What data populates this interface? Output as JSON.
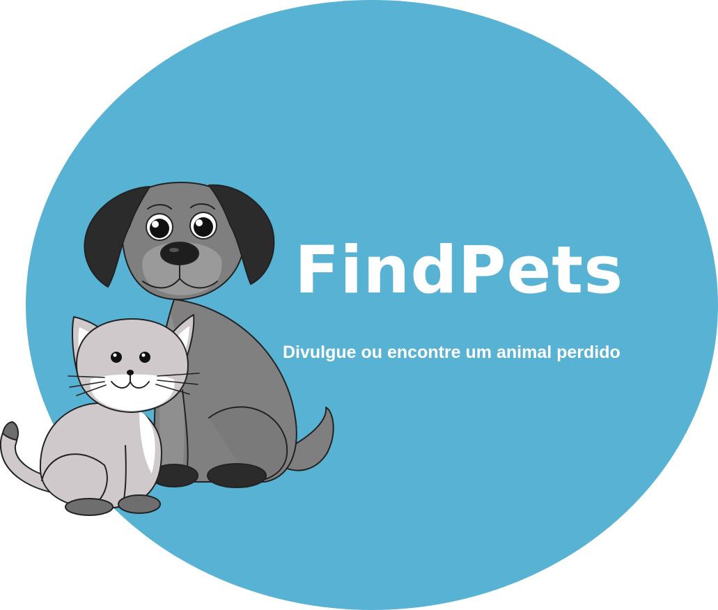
{
  "brand": {
    "title": "FindPets",
    "tagline": "Divulgue ou encontre um animal perdido"
  },
  "illustration": {
    "icons": [
      "dog-icon",
      "cat-icon"
    ]
  },
  "colors": {
    "background": "#57B2D4",
    "text": "#FFFFFF",
    "dog_body": "#7F7F7F",
    "dog_ears": "#2B2B2B",
    "cat_body": "#CFC9CB",
    "cat_face": "#FFFFFF"
  }
}
